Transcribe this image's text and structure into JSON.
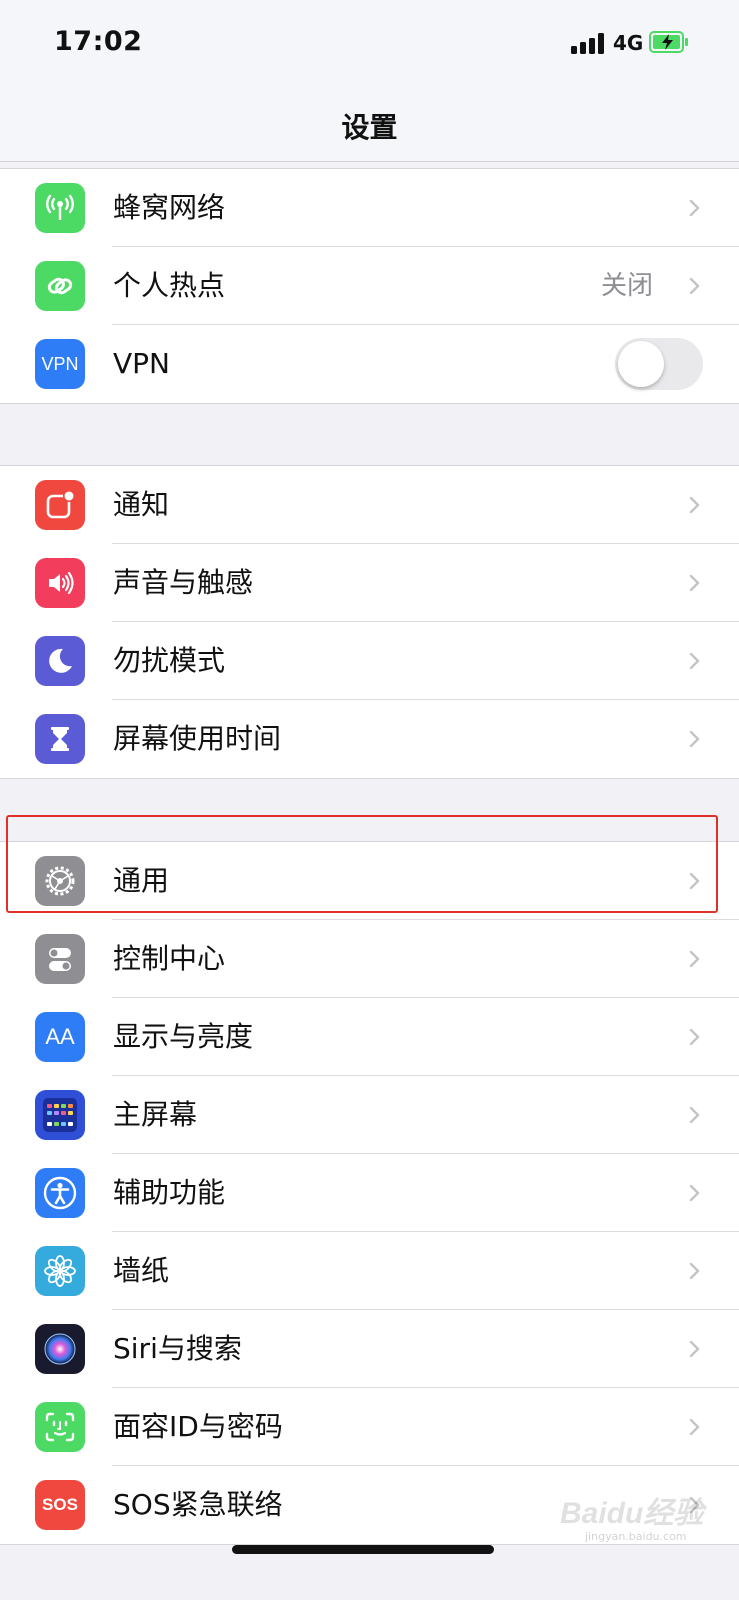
{
  "status_bar": {
    "time": "17:02",
    "network": "4G"
  },
  "nav": {
    "title": "设置"
  },
  "groups": [
    {
      "items": [
        {
          "label": "蜂窝网络",
          "icon": "cellular-icon",
          "color": "#4cd964"
        },
        {
          "label": "个人热点",
          "value": "关闭",
          "icon": "hotspot-icon",
          "color": "#4cd964"
        },
        {
          "label": "VPN",
          "icon": "vpn-icon",
          "icon_text": "VPN",
          "color": "#2f7df6",
          "toggle_on": false
        }
      ]
    },
    {
      "items": [
        {
          "label": "通知",
          "icon": "notifications-icon",
          "color": "#f0483e"
        },
        {
          "label": "声音与触感",
          "icon": "sound-icon",
          "color": "#f23e5c"
        },
        {
          "label": "勿扰模式",
          "icon": "moon-icon",
          "color": "#5b5bd6"
        },
        {
          "label": "屏幕使用时间",
          "icon": "hourglass-icon",
          "color": "#5b5bd6"
        }
      ]
    },
    {
      "items": [
        {
          "label": "通用",
          "icon": "gear-icon",
          "color": "#8e8e93",
          "highlighted": true
        },
        {
          "label": "控制中心",
          "icon": "control-center-icon",
          "color": "#8e8e93"
        },
        {
          "label": "显示与亮度",
          "icon": "display-icon",
          "icon_text": "AA",
          "color": "#2f7df6"
        },
        {
          "label": "主屏幕",
          "icon": "home-screen-icon",
          "color": "#2f4fd6"
        },
        {
          "label": "辅助功能",
          "icon": "accessibility-icon",
          "color": "#2f7df6"
        },
        {
          "label": "墙纸",
          "icon": "wallpaper-icon",
          "color": "#35aadc"
        },
        {
          "label": "Siri与搜索",
          "icon": "siri-icon",
          "color": "#1a1a2e"
        },
        {
          "label": "面容ID与密码",
          "icon": "face-id-icon",
          "color": "#4cd964"
        },
        {
          "label": "SOS紧急联络",
          "icon": "sos-icon",
          "icon_text": "SOS",
          "color": "#f0483e"
        }
      ]
    }
  ],
  "watermark": {
    "text": "Baidu经验",
    "sub": "jingyan.baidu.com"
  }
}
